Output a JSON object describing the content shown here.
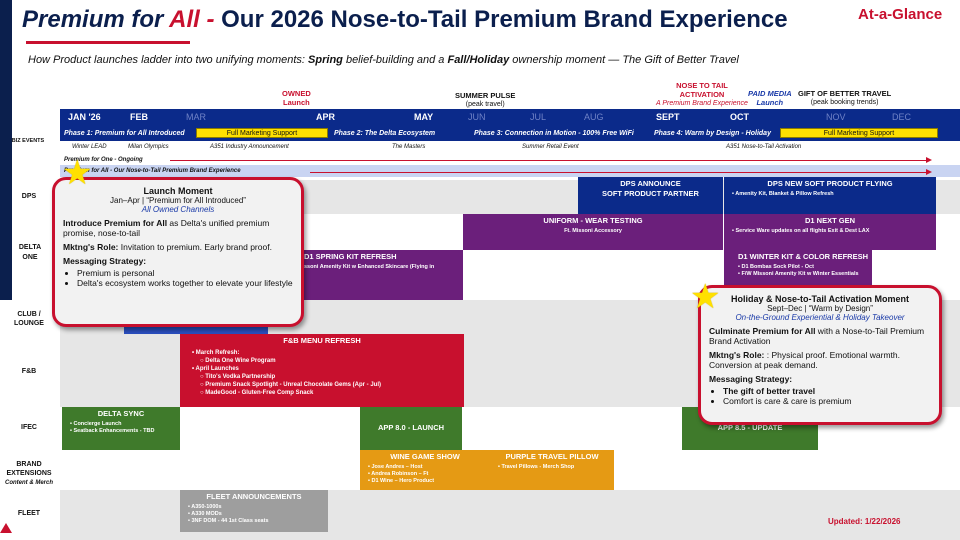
{
  "header": {
    "title_part1": "Premium for ",
    "title_part2": "All",
    "title_sep": " - ",
    "title_rest": " Our 2026 Nose-to-Tail Premium Brand Experience",
    "at_a_glance": "At-a-Glance",
    "subtitle_a": "How Product launches ladder into two unifying moments: ",
    "subtitle_b": "Spring",
    "subtitle_c": " belief-building and a ",
    "subtitle_d": "Fall/Holiday",
    "subtitle_e": " ownership moment — The Gift of Better Travel"
  },
  "markers": {
    "owned": "OWNED",
    "owned_sub": "Launch",
    "summer": "SUMMER PULSE",
    "summer_sub": "(peak travel)",
    "n2t1": "NOSE TO TAIL",
    "n2t2": "ACTIVATION",
    "n2t_sub": "A Premium Brand Experience",
    "paid1": "PAID MEDIA",
    "paid2": "Launch",
    "gift": "GIFT OF BETTER TRAVEL",
    "gift_sub": "(peak booking trends)"
  },
  "months": [
    "JAN '26",
    "FEB",
    "MAR",
    "APR",
    "MAY",
    "JUN",
    "JUL",
    "AUG",
    "SEPT",
    "OCT",
    "NOV",
    "DEC"
  ],
  "phases": {
    "p1": "Phase 1: Premium for All  Introduced",
    "p1_tag": "Full Marketing Support",
    "p2": "Phase 2: The Delta Ecosystem",
    "p3": "Phase 3: Connection in Motion - 100% Free WiFi",
    "p4": "Phase 4: Warm by Design - Holiday",
    "p4_tag": "Full Marketing Support"
  },
  "rows": {
    "biz": "BIZ EVENTS",
    "dps": "DPS",
    "delta_one": "DELTA ONE",
    "club": "CLUB / LOUNGE",
    "fb": "F&B",
    "ifec": "IFEC",
    "brand": "BRAND EXTENSIONS",
    "brand_sub": "Content & Merch",
    "fleet": "FLEET"
  },
  "events": {
    "e1": "Winter LEAD",
    "e2": "Milan Olympics",
    "e3": "A351 Industry Announcement",
    "e4": "The Masters",
    "e5": "Summer Retail Event",
    "e6": "A351 Nose-to-Tail Activation",
    "ongoing": "Premium for One  -  Ongoing",
    "ongoing2": "Premium for All  -  Our Nose-to-Tail Premium Brand Experience"
  },
  "blocks": {
    "dps_ann1": "DPS ANNOUNCE",
    "dps_ann2": "SOFT PRODUCT PARTNER",
    "dps_new": "DPS  NEW SOFT PRODUCT FLYING",
    "dps_new_b1": "Amenity Kit, Blanket & Pillow Refresh",
    "uniform": "UNIFORM - WEAR TESTING",
    "uniform_sub": "Ft. Missoni Accessory",
    "d1next": "D1 NEXT GEN",
    "d1next_sub": "Service Ware updates on all flights Exit & Dest LAX",
    "spring_kit": "D1  SPRING KIT REFRESH",
    "spring_kit_sub": "ssoni Amenity Kit w Enhanced Skincare (Flying in",
    "winter_kit": "D1  WINTER KIT & COLOR REFRESH",
    "winter_b1": "D1 Bombas Sock Pilot - Oct",
    "winter_b2": "F/W Missoni Amenity Kit w Winter Essentials",
    "fb": "F&B  MENU REFRESH",
    "fb_b1": "March Refresh:",
    "fb_b1a": "Delta One Wine Program",
    "fb_b2": "April Launches",
    "fb_b2a": "Tito's Vodka Partnership",
    "fb_b2b": "Premium Snack Spotlight - Unreal Chocolate Gems (Apr - Jul)",
    "fb_b2c": "MadeGood - Gluten-Free Comp Snack",
    "sync": "DELTA SYNC",
    "sync_b1": "Concierge Launch",
    "sync_b2": "Seatback Enhancements - TBD",
    "app8": "APP 8.0 - LAUNCH",
    "app85": "APP 8.5 - UPDATE",
    "wine": "WINE GAME SHOW",
    "wine_b1": "Jose Andres – Host",
    "wine_b2": "Andrea Robinson – Ft",
    "wine_b3": "D1 Wine – Hero Product",
    "pillow": "PURPLE TRAVEL PILLOW",
    "pillow_b1": "Travel Pillows - Merch Shop",
    "fleet": "FLEET ANNOUNCEMENTS",
    "fleet_b1": "A350-1000s",
    "fleet_b2": "A330 MODs",
    "fleet_b3": "3NF DOM - 44 1st Class seats"
  },
  "popup_left": {
    "title": "Launch Moment",
    "dates": "Jan–Apr | “Premium for All Introduced”",
    "channel": "All Owned Channels",
    "p1_b": "Introduce Premium for All",
    "p1": " as Delta's unified premium promise, nose-to-tail",
    "p2_b": "Mktng's Role:",
    "p2": " Invitation to premium. Early brand proof.",
    "p3_b": "Messaging Strategy:",
    "li1": "Premium is personal",
    "li2": "Delta's ecosystem works together to elevate your lifestyle"
  },
  "popup_right": {
    "title": "Holiday & Nose-to-Tail Activation Moment",
    "dates": "Sept–Dec | “Warm by Design”",
    "channel": "On-the-Ground Experiential & Holiday Takeover",
    "p1_b": "Culminate Premium for All",
    "p1": " with a Nose-to-Tail Premium Brand Activation",
    "p2_b": "Mktng's Role:",
    "p2": " : Physical proof. Emotional warmth. Conversion at peak demand.",
    "p3_b": "Messaging Strategy:",
    "li1": "The gift of better travel",
    "li2": "Comfort is care & care is premium"
  },
  "footer": {
    "updated": "Updated: 1/22/2026"
  },
  "colors": {
    "navy": "#0b2a8a",
    "red": "#c8102e",
    "purple": "#6b1f7b",
    "green": "#3f7a2b",
    "orange": "#e59a14",
    "gray": "#9e9e9e"
  }
}
